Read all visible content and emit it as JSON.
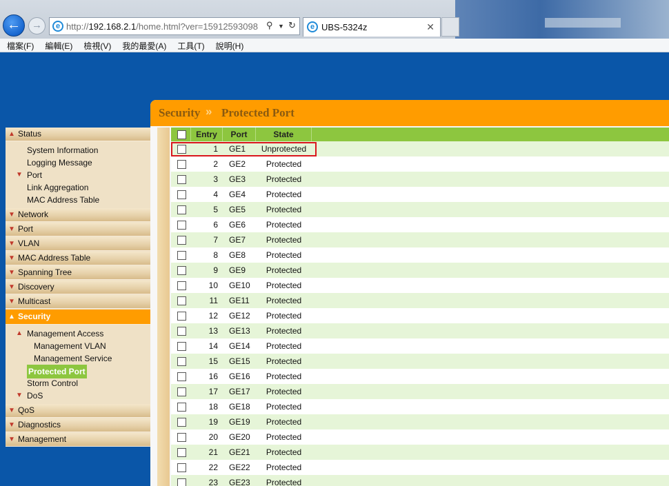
{
  "browser": {
    "url_prefix": "http://",
    "url_host": "192.168.2.1",
    "url_path": "/home.html?ver=15912593098",
    "tab_title": "UBS-5324z",
    "menu": [
      "檔案(F)",
      "編輯(E)",
      "檢視(V)",
      "我的最愛(A)",
      "工具(T)",
      "說明(H)"
    ]
  },
  "header": {
    "section": "Security",
    "separator": "»",
    "page": "Protected Port"
  },
  "sidebar": {
    "groups_before": [
      "Status"
    ],
    "status_items": [
      {
        "label": "System Information",
        "indent": 1
      },
      {
        "label": "Logging Message",
        "indent": 1
      },
      {
        "label": "Port",
        "indent": 1,
        "arrow": true
      },
      {
        "label": "Link Aggregation",
        "indent": 1
      },
      {
        "label": "MAC Address Table",
        "indent": 1
      }
    ],
    "groups_mid": [
      "Network",
      "Port",
      "VLAN",
      "MAC Address Table",
      "Spanning Tree",
      "Discovery",
      "Multicast"
    ],
    "active_group": "Security",
    "security_items": [
      {
        "label": "Management Access",
        "indent": 1,
        "arrow": true
      },
      {
        "label": "Management VLAN",
        "indent": 2
      },
      {
        "label": "Management Service",
        "indent": 2
      },
      {
        "label": "Protected Port",
        "indent": 1,
        "highlight": true
      },
      {
        "label": "Storm Control",
        "indent": 1
      },
      {
        "label": "DoS",
        "indent": 1,
        "arrow": true
      }
    ],
    "groups_after": [
      "QoS",
      "Diagnostics",
      "Management"
    ]
  },
  "table": {
    "columns": [
      "Entry",
      "Port",
      "State"
    ],
    "rows": [
      {
        "entry": "1",
        "port": "GE1",
        "state": "Unprotected"
      },
      {
        "entry": "2",
        "port": "GE2",
        "state": "Protected"
      },
      {
        "entry": "3",
        "port": "GE3",
        "state": "Protected"
      },
      {
        "entry": "4",
        "port": "GE4",
        "state": "Protected"
      },
      {
        "entry": "5",
        "port": "GE5",
        "state": "Protected"
      },
      {
        "entry": "6",
        "port": "GE6",
        "state": "Protected"
      },
      {
        "entry": "7",
        "port": "GE7",
        "state": "Protected"
      },
      {
        "entry": "8",
        "port": "GE8",
        "state": "Protected"
      },
      {
        "entry": "9",
        "port": "GE9",
        "state": "Protected"
      },
      {
        "entry": "10",
        "port": "GE10",
        "state": "Protected"
      },
      {
        "entry": "11",
        "port": "GE11",
        "state": "Protected"
      },
      {
        "entry": "12",
        "port": "GE12",
        "state": "Protected"
      },
      {
        "entry": "13",
        "port": "GE13",
        "state": "Protected"
      },
      {
        "entry": "14",
        "port": "GE14",
        "state": "Protected"
      },
      {
        "entry": "15",
        "port": "GE15",
        "state": "Protected"
      },
      {
        "entry": "16",
        "port": "GE16",
        "state": "Protected"
      },
      {
        "entry": "17",
        "port": "GE17",
        "state": "Protected"
      },
      {
        "entry": "18",
        "port": "GE18",
        "state": "Protected"
      },
      {
        "entry": "19",
        "port": "GE19",
        "state": "Protected"
      },
      {
        "entry": "20",
        "port": "GE20",
        "state": "Protected"
      },
      {
        "entry": "21",
        "port": "GE21",
        "state": "Protected"
      },
      {
        "entry": "22",
        "port": "GE22",
        "state": "Protected"
      },
      {
        "entry": "23",
        "port": "GE23",
        "state": "Protected"
      }
    ]
  },
  "colors": {
    "page_bg": "#0a56a8",
    "accent_orange": "#ff9c00",
    "table_header_green": "#8dc63f",
    "row_stripe": "#e6f5d8",
    "highlight_red": "#d9161c"
  }
}
